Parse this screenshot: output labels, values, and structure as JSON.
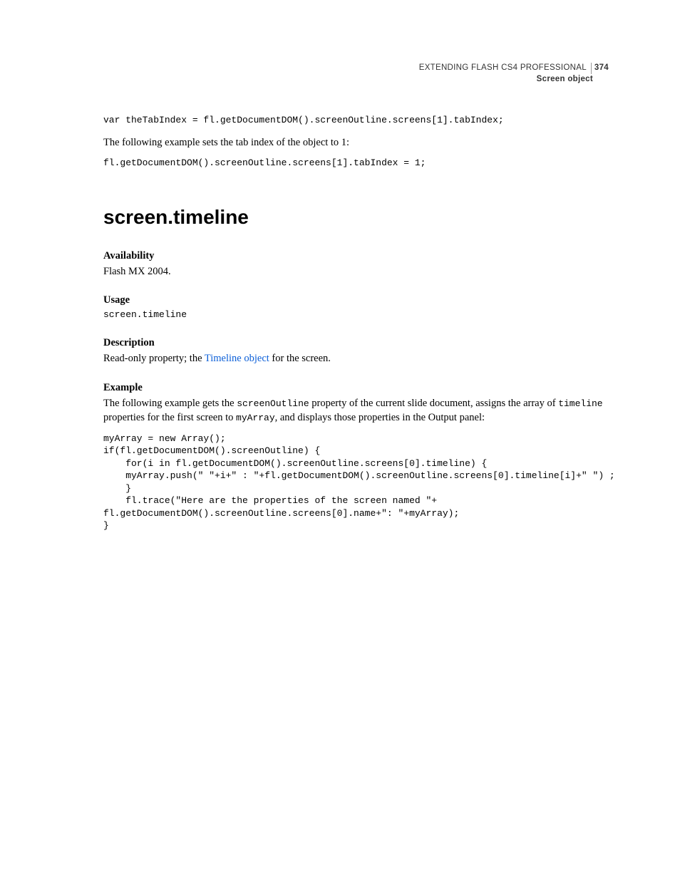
{
  "header": {
    "book_title": "EXTENDING FLASH CS4 PROFESSIONAL",
    "page_number": "374",
    "section": "Screen object"
  },
  "top": {
    "code1": "var theTabIndex = fl.getDocumentDOM().screenOutline.screens[1].tabIndex;",
    "para1": "The following example sets the tab index of the object to 1:",
    "code2": "fl.getDocumentDOM().screenOutline.screens[1].tabIndex = 1;"
  },
  "api": {
    "title": "screen.timeline",
    "availability_label": "Availability",
    "availability_text": "Flash MX 2004.",
    "usage_label": "Usage",
    "usage_code": "screen.timeline",
    "description_label": "Description",
    "description_pre": "Read-only property; the ",
    "description_link": "Timeline object",
    "description_post": " for the screen.",
    "example_label": "Example",
    "example_para_pre": "The following example gets the ",
    "example_inline1": "screenOutline",
    "example_para_mid1": " property of the current slide document, assigns the array of ",
    "example_inline2": "timeline",
    "example_para_mid2": " properties for the first screen to ",
    "example_inline3": "myArray",
    "example_para_post": ", and displays those properties in the Output panel:",
    "example_code": "myArray = new Array();\nif(fl.getDocumentDOM().screenOutline) {\n    for(i in fl.getDocumentDOM().screenOutline.screens[0].timeline) {\n    myArray.push(\" \"+i+\" : \"+fl.getDocumentDOM().screenOutline.screens[0].timeline[i]+\" \") ;\n    }\n    fl.trace(\"Here are the properties of the screen named \"+\nfl.getDocumentDOM().screenOutline.screens[0].name+\": \"+myArray);\n}"
  }
}
